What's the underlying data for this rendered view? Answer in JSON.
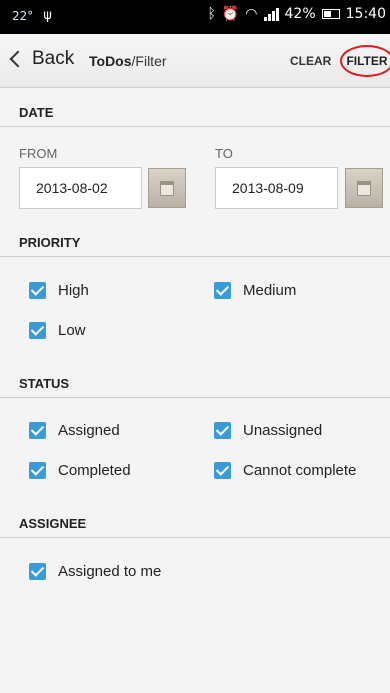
{
  "statusbar": {
    "temperature": "22°",
    "battery": "42%",
    "time": "15:40"
  },
  "actionbar": {
    "back_label": "Back",
    "crumb_app": "ToDos",
    "crumb_sep": "/",
    "crumb_page": "Filter",
    "clear_label": "CLEAR",
    "filter_label": "FILTER"
  },
  "date": {
    "header": "DATE",
    "from_label": "FROM",
    "to_label": "TO",
    "from_value": "2013-08-02",
    "to_value": "2013-08-09"
  },
  "priority": {
    "header": "PRIORITY",
    "options": [
      {
        "label": "High",
        "checked": true
      },
      {
        "label": "Medium",
        "checked": true
      },
      {
        "label": "Low",
        "checked": true
      }
    ]
  },
  "status": {
    "header": "STATUS",
    "options": [
      {
        "label": "Assigned",
        "checked": true
      },
      {
        "label": "Unassigned",
        "checked": true
      },
      {
        "label": "Completed",
        "checked": true
      },
      {
        "label": "Cannot complete",
        "checked": true
      }
    ]
  },
  "assignee": {
    "header": "ASSIGNEE",
    "options": [
      {
        "label": "Assigned to me",
        "checked": true
      }
    ]
  },
  "colors": {
    "checkbox": "#3a9bd9",
    "highlight_circle": "#e31b1b"
  }
}
